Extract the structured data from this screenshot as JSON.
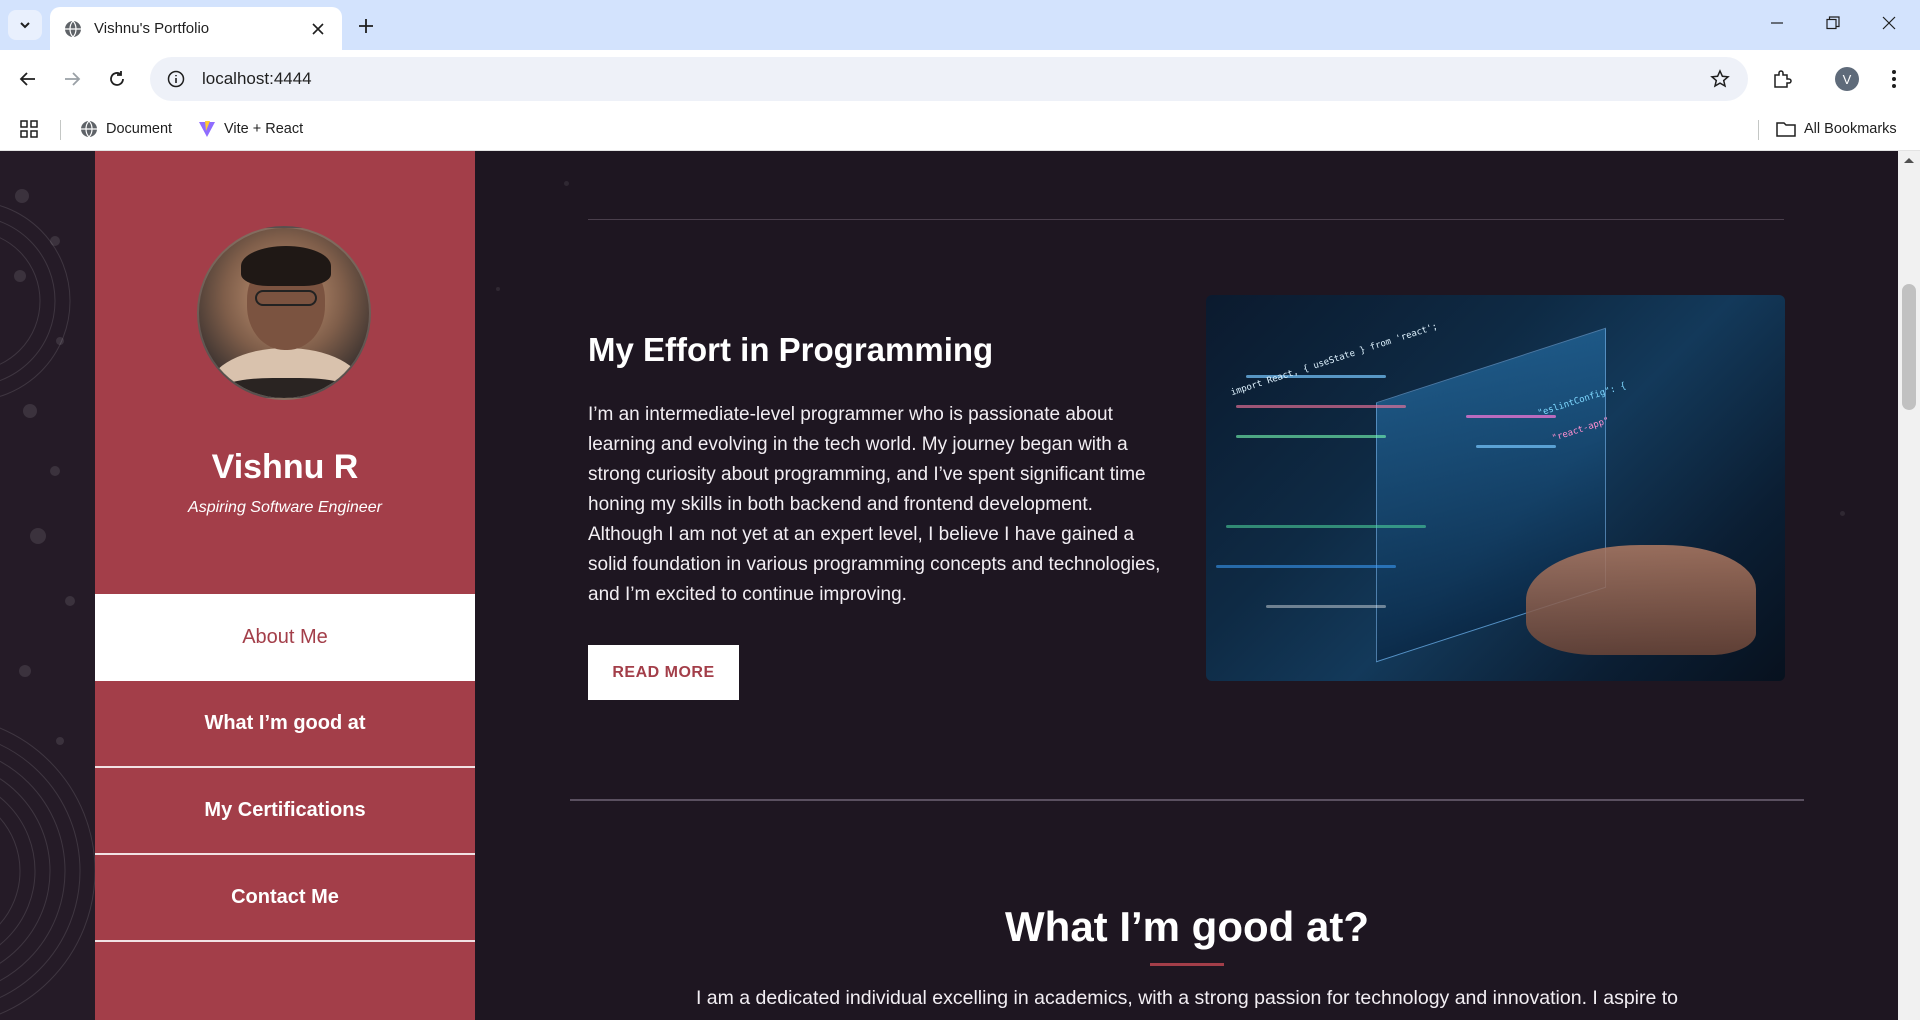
{
  "browser": {
    "tab_title": "Vishnu's Portfolio",
    "url": "localhost:4444",
    "profile_initial": "V",
    "bookmarks": [
      {
        "label": "Document"
      },
      {
        "label": "Vite + React"
      }
    ],
    "all_bookmarks_label": "All Bookmarks"
  },
  "sidebar": {
    "name": "Vishnu R",
    "role": "Aspiring Software Engineer",
    "nav": [
      {
        "label": "About Me",
        "active": true
      },
      {
        "label": "What I’m good at",
        "active": false
      },
      {
        "label": "My Certifications",
        "active": false
      },
      {
        "label": "Contact Me",
        "active": false
      }
    ]
  },
  "main": {
    "effort": {
      "title": "My Effort in Programming",
      "text": "I’m an intermediate-level programmer who is passionate about learning and evolving in the tech world. My journey began with a strong curiosity about programming, and I’ve spent significant time honing my skills in both backend and frontend development. Although I am not yet at an expert level, I believe I have gained a solid foundation in various programming concepts and technologies, and I’m excited to continue improving.",
      "button": "READ MORE"
    },
    "good_at": {
      "title": "What I’m good at?",
      "text": "I am a dedicated individual excelling in academics, with a strong passion for technology and innovation. I aspire to"
    }
  },
  "colors": {
    "accent": "#a33e49",
    "page_bg": "#1e1621",
    "chrome_tabbar": "#d3e3fd"
  }
}
